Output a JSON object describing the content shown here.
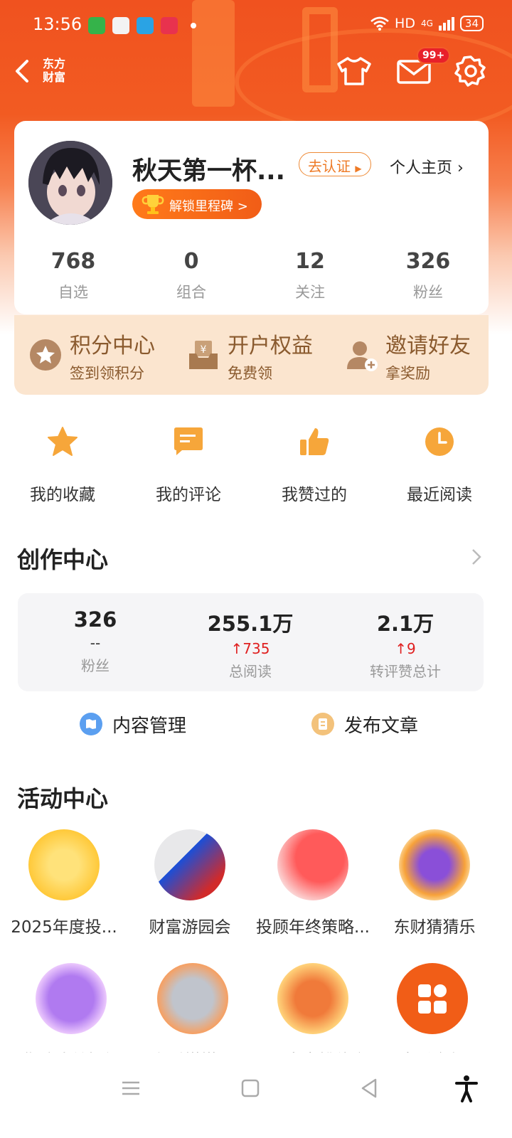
{
  "status": {
    "time": "13:56",
    "hd": "HD",
    "net": "4G",
    "battery": "34"
  },
  "nav": {
    "brand_line1": "东方",
    "brand_line2": "财富",
    "msg_badge": "99+"
  },
  "profile": {
    "name": "秋天第一杯...",
    "verify": "去认证",
    "homepage": "个人主页",
    "milestone": "解锁里程碑 >",
    "stats": [
      {
        "value": "768",
        "label": "自选"
      },
      {
        "value": "0",
        "label": "组合"
      },
      {
        "value": "12",
        "label": "关注"
      },
      {
        "value": "326",
        "label": "粉丝"
      }
    ]
  },
  "perks": [
    {
      "title": "积分中心",
      "sub": "签到领积分"
    },
    {
      "title": "开户权益",
      "sub": "免费领"
    },
    {
      "title": "邀请好友",
      "sub": "拿奖励"
    }
  ],
  "quick": [
    {
      "label": "我的收藏"
    },
    {
      "label": "我的评论"
    },
    {
      "label": "我赞过的"
    },
    {
      "label": "最近阅读"
    }
  ],
  "creator": {
    "title": "创作中心",
    "stats": [
      {
        "value": "326",
        "delta": "--",
        "label": "粉丝"
      },
      {
        "value": "255.1万",
        "delta": "↑735",
        "label": "总阅读"
      },
      {
        "value": "2.1万",
        "delta": "↑9",
        "label": "转评赞总计"
      }
    ],
    "manage": "内容管理",
    "publish": "发布文章"
  },
  "activity": {
    "title": "活动中心",
    "items": [
      {
        "label": "2025年度投..."
      },
      {
        "label": "财富游园会"
      },
      {
        "label": "投顾年终策略..."
      },
      {
        "label": "东财猜猜乐"
      },
      {
        "label": "集碎片兑好礼"
      },
      {
        "label": "东财攒攒乐"
      },
      {
        "label": "A股宝良排位赛"
      },
      {
        "label": "查看全部"
      }
    ]
  },
  "colors": {
    "accent": "#f15d17",
    "up": "#e02020",
    "perk_text": "#8a5a2e"
  }
}
